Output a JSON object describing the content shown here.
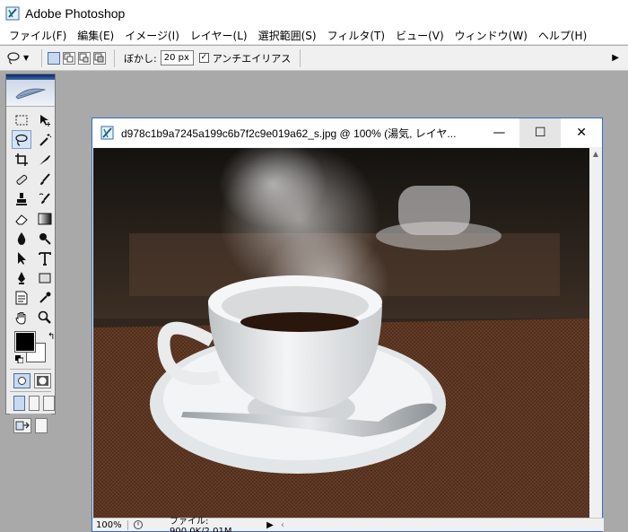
{
  "app": {
    "title": "Adobe Photoshop",
    "menu": [
      "ファイル(F)",
      "編集(E)",
      "イメージ(I)",
      "レイヤー(L)",
      "選択範囲(S)",
      "フィルタ(T)",
      "ビュー(V)",
      "ウィンドウ(W)",
      "ヘルプ(H)"
    ]
  },
  "options": {
    "feather_label": "ぼかし:",
    "feather_value": "20 px",
    "antialias_label": "アンチエイリアス",
    "antialias_checked": "☑"
  },
  "document": {
    "title": "d978c1b9a7245a199c6b7f2c9e019a62_s.jpg @ 100% (湯気, レイヤ...",
    "zoom": "100%",
    "file_info": "ファイル: 900.0K/2.01M",
    "minimize_glyph": "—",
    "maximize_glyph": "☐",
    "close_glyph": "✕"
  },
  "icons": {
    "lasso": "lasso-icon",
    "marquee": "marquee-icon",
    "move": "move-icon"
  },
  "colors": {
    "foreground": "#000000",
    "background": "#ffffff",
    "accent": "#2f6ecb"
  }
}
